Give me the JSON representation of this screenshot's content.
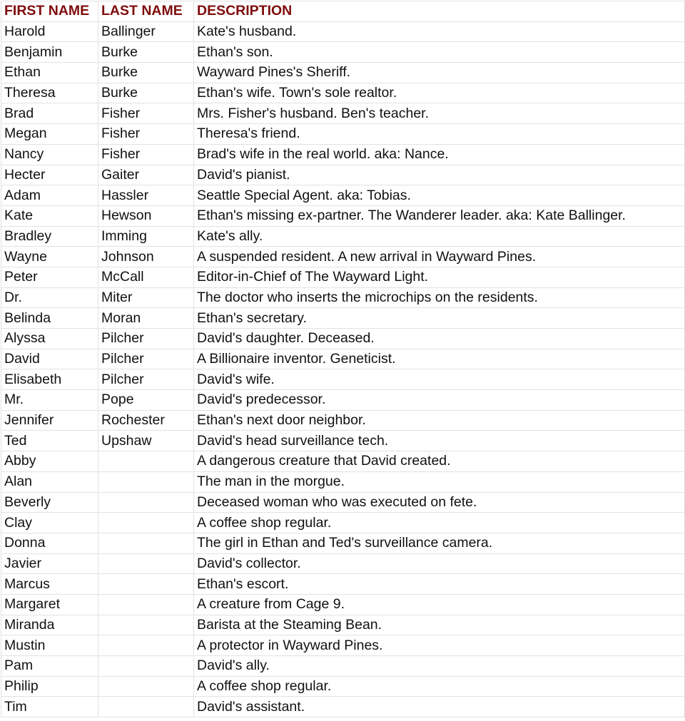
{
  "table": {
    "header_color": "#7f0c0c",
    "headers": [
      "FIRST NAME",
      "LAST NAME",
      "DESCRIPTION"
    ],
    "rows": [
      [
        "Harold",
        "Ballinger",
        "Kate's husband."
      ],
      [
        "Benjamin",
        "Burke",
        "Ethan's son."
      ],
      [
        "Ethan",
        "Burke",
        "Wayward Pines's Sheriff."
      ],
      [
        "Theresa",
        "Burke",
        "Ethan's wife. Town's sole realtor."
      ],
      [
        "Brad",
        "Fisher",
        "Mrs. Fisher's husband. Ben's teacher."
      ],
      [
        "Megan",
        "Fisher",
        "Theresa's friend."
      ],
      [
        "Nancy",
        "Fisher",
        "Brad's wife in the real world. aka: Nance."
      ],
      [
        "Hecter",
        "Gaiter",
        "David's pianist."
      ],
      [
        "Adam",
        "Hassler",
        "Seattle Special Agent. aka: Tobias."
      ],
      [
        "Kate",
        "Hewson",
        "Ethan's missing ex-partner. The Wanderer leader. aka: Kate Ballinger."
      ],
      [
        "Bradley",
        "Imming",
        "Kate's ally."
      ],
      [
        "Wayne",
        "Johnson",
        "A suspended resident. A new arrival in Wayward Pines."
      ],
      [
        "Peter",
        "McCall",
        "Editor-in-Chief of The Wayward Light."
      ],
      [
        "Dr.",
        "Miter",
        "The doctor who inserts the microchips on the residents."
      ],
      [
        "Belinda",
        "Moran",
        "Ethan's secretary."
      ],
      [
        "Alyssa",
        "Pilcher",
        "David's daughter. Deceased."
      ],
      [
        "David",
        "Pilcher",
        "A Billionaire inventor. Geneticist."
      ],
      [
        "Elisabeth",
        "Pilcher",
        "David's wife."
      ],
      [
        "Mr.",
        "Pope",
        "David's predecessor."
      ],
      [
        "Jennifer",
        "Rochester",
        "Ethan's next door neighbor."
      ],
      [
        "Ted",
        "Upshaw",
        "David's head surveillance tech."
      ],
      [
        "Abby",
        "",
        "A dangerous creature that David created."
      ],
      [
        "Alan",
        "",
        "The man in the morgue."
      ],
      [
        "Beverly",
        "",
        "Deceased woman who was executed on fete."
      ],
      [
        "Clay",
        "",
        "A coffee shop regular."
      ],
      [
        "Donna",
        "",
        "The girl in Ethan and Ted's surveillance camera."
      ],
      [
        "Javier",
        "",
        "David's collector."
      ],
      [
        "Marcus",
        "",
        "Ethan's escort."
      ],
      [
        "Margaret",
        "",
        "A creature from Cage 9."
      ],
      [
        "Miranda",
        "",
        "Barista at the Steaming Bean."
      ],
      [
        "Mustin",
        "",
        "A protector in Wayward Pines."
      ],
      [
        "Pam",
        "",
        "David's ally."
      ],
      [
        "Philip",
        "",
        "A coffee shop regular."
      ],
      [
        "Tim",
        "",
        "David's assistant."
      ]
    ]
  }
}
